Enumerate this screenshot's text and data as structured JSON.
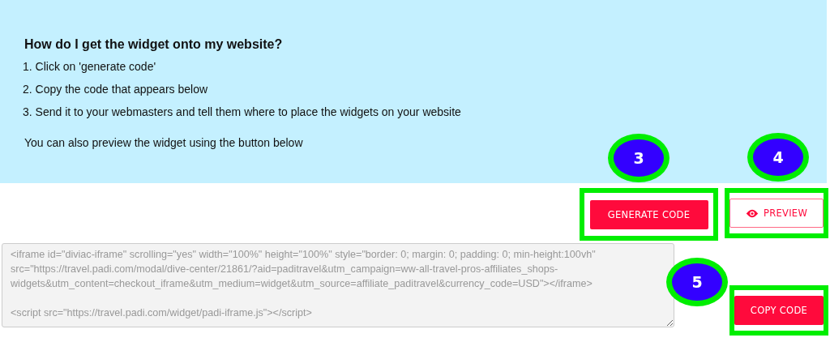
{
  "instructions": {
    "title": "How do I get the widget onto my website?",
    "steps": [
      "1. Click on 'generate code'",
      "2. Copy the code that appears below",
      "3. Send it to your webmasters and tell them where to place the widgets on your website"
    ],
    "note": "You can also preview the widget using the button below"
  },
  "actions": [
    {
      "label": "GENERATE CODE",
      "kind": "primary",
      "highlighted": true,
      "callout": "3"
    },
    {
      "label": "PREVIEW",
      "kind": "outline",
      "highlighted": true,
      "callout": "4"
    }
  ],
  "code_box": {
    "value": "<iframe id=\"diviac-iframe\" scrolling=\"yes\" width=\"100%\" height=\"100%\" style=\"border: 0; margin: 0; padding: 0; min-height:100vh\" src=\"https://travel.padi.com/modal/dive-center/21861/?aid=paditravel&utm_campaign=ww-all-travel-pros-affiliates_shops-widgets&utm_content=checkout_iframe&utm_medium=widget&utm_source=affiliate_paditravel&currency_code=USD\"></iframe>\n\n<script src=\"https://travel.padi.com/widget/padi-iframe.js\"></script>"
  },
  "copy_button": {
    "label": "COPY CODE",
    "kind": "primary",
    "highlighted": true,
    "callout": "5"
  }
}
